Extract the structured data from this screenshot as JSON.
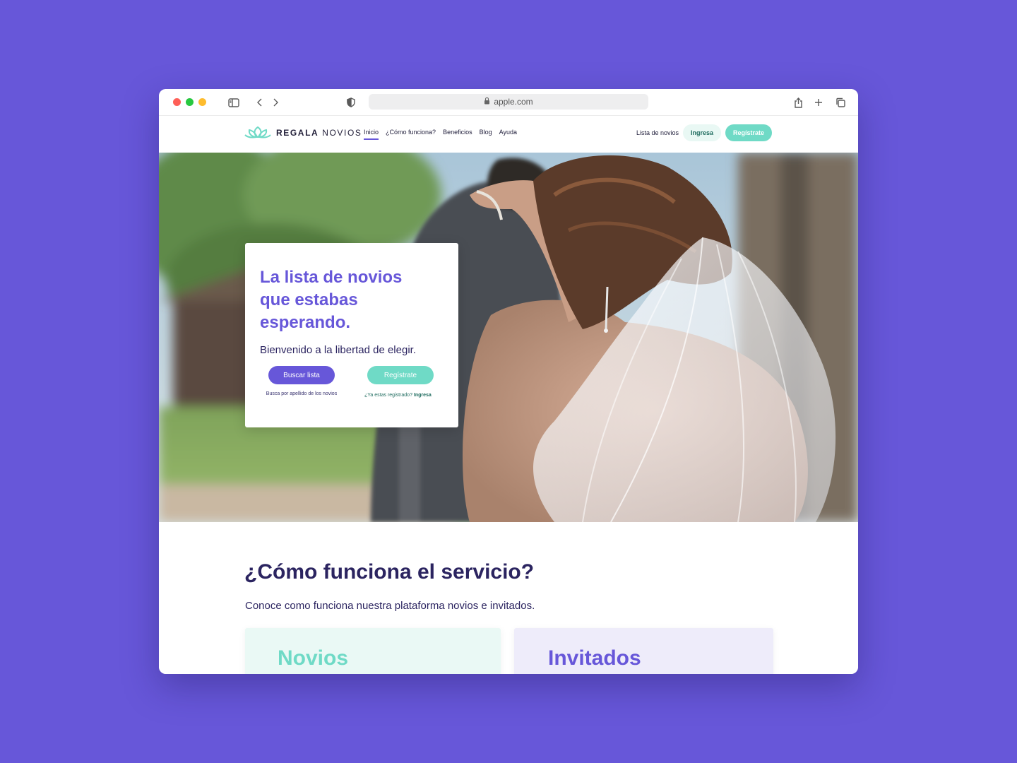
{
  "browser": {
    "url": "apple.com",
    "icons": [
      "sidebar-icon",
      "back-icon",
      "forward-icon",
      "shield-icon",
      "lock-icon",
      "share-icon",
      "plus-icon",
      "tabs-icon"
    ]
  },
  "nav": {
    "logo_bold": "REGALA",
    "logo_light": "NOVIOS",
    "links": [
      "Inicio",
      "¿Cómo funciona?",
      "Beneficios",
      "Blog",
      "Ayuda"
    ],
    "active_link": "Inicio",
    "lista_link": "Lista de novios",
    "login_button": "Ingresa",
    "register_button": "Regístrate"
  },
  "hero": {
    "title": "La lista de novios que estabas esperando.",
    "subtitle": "Bienvenido a la libertad de elegir.",
    "search_button": "Buscar lista",
    "search_hint": "Busca por apellido de los novios",
    "register_button": "Regístrate",
    "registered_question": "¿Ya estas registrado?",
    "registered_link": "Ingresa"
  },
  "section": {
    "title": "¿Cómo funciona el servicio?",
    "subtitle": "Conoce como funciona nuestra plataforma novios e invitados.",
    "cards": [
      "Novios",
      "Invitados"
    ]
  },
  "colors": {
    "background": "#6757D9",
    "primary": "#6757D9",
    "accent": "#6FDAC6",
    "dark_text": "#2B2460"
  }
}
